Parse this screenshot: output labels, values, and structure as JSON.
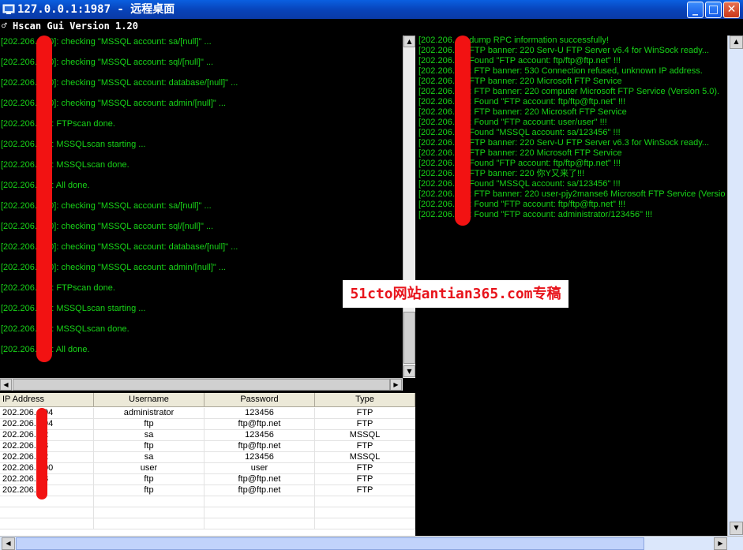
{
  "window": {
    "title": "127.0.0.1:1987 - 远程桌面",
    "minimize_glyph": "_",
    "maximize_glyph": "□",
    "close_glyph": "✕"
  },
  "app": {
    "title": "Hscan Gui Version 1.20"
  },
  "left_log": {
    "lines": [
      "[202.206.   100]: checking \"MSSQL account: sa/[null]\" ...",
      "[202.206.   100]: checking \"MSSQL account: sql/[null]\" ...",
      "[202.206.   100]: checking \"MSSQL account: database/[null]\" ...",
      "[202.206.   100]: checking \"MSSQL account: admin/[null]\" ...",
      "[202.206.   06]: FTPscan done.",
      "[202.206.   06]: MSSQLscan starting ...",
      "[202.206.   06]: MSSQLscan done.",
      "[202.206.   06]: All done.",
      "[202.206.   100]: checking \"MSSQL account: sa/[null]\" ...",
      "[202.206.   100]: checking \"MSSQL account: sql/[null]\" ...",
      "[202.206.   100]: checking \"MSSQL account: database/[null]\" ...",
      "[202.206.   100]: checking \"MSSQL account: admin/[null]\" ...",
      "[202.206.   94]: FTPscan done.",
      "[202.206.   94]: MSSQLscan starting ...",
      "[202.206.   94]: MSSQLscan done.",
      "[202.206.   94]: All done."
    ]
  },
  "right_log": {
    "lines": [
      "[202.206.    3]: dump RPC information successfully!",
      "[202.206.    1]: FTP banner: 220 Serv-U FTP Server v6.4 for WinSock ready...",
      "[202.206.    1]: Found \"FTP account: ftp/ftp@ftp.net\"  !!!",
      "[202.206.    01]: FTP banner: 530 Connection refused, unknown IP address.",
      "[202.206.    8]: FTP banner: 220 Microsoft FTP Service",
      "[202.206.    28]: FTP banner: 220 computer Microsoft FTP Service (Version 5.0).",
      "[202.206.    28]: Found \"FTP account: ftp/ftp@ftp.net\"  !!!",
      "[202.206.    00]: FTP banner: 220 Microsoft FTP Service",
      "[202.206.    00]: Found \"FTP account: user/user\" !!!",
      "[202.206.    2]: Found \"MSSQL account: sa/123456\" !!!",
      "[202.206.    7]: FTP banner: 220 Serv-U FTP Server v6.3 for WinSock ready...",
      "[202.206.    8]: FTP banner: 220 Microsoft FTP Service",
      "[202.206.    8]: Found \"FTP account: ftp/ftp@ftp.net\"  !!!",
      "[202.206.    6]: FTP banner: 220 你Y又来了!!!",
      "[202.206.    2]: Found \"MSSQL account: sa/123456\" !!!",
      "[202.206.    94]: FTP banner: 220 user-pjy2manse6 Microsoft FTP Service (Versio",
      "[202.206.    94]: Found \"FTP account: ftp/ftp@ftp.net\"  !!!",
      "[202.206.    94]: Found \"FTP account: administrator/123456\" !!!"
    ]
  },
  "results_table": {
    "columns": [
      "IP Address",
      "Username",
      "Password",
      "Type"
    ],
    "rows": [
      [
        "202.206.      194",
        "administrator",
        "123456",
        "FTP"
      ],
      [
        "202.206.      194",
        "ftp",
        "ftp@ftp.net",
        "FTP"
      ],
      [
        "202.206.      12",
        "sa",
        "123456",
        "MSSQL"
      ],
      [
        "202.206.      98",
        "ftp",
        "ftp@ftp.net",
        "FTP"
      ],
      [
        "202.206.      12",
        "sa",
        "123456",
        "MSSQL"
      ],
      [
        "202.206.      100",
        "user",
        "user",
        "FTP"
      ],
      [
        "202.206.      28",
        "ftp",
        "ftp@ftp.net",
        "FTP"
      ],
      [
        "202.206.      11",
        "ftp",
        "ftp@ftp.net",
        "FTP"
      ]
    ]
  },
  "watermark": {
    "text": "51cto网站antian365.com专稿"
  },
  "colors": {
    "log_text": "#18d418",
    "redaction": "#f21212",
    "watermark_text": "#e8141c",
    "titlebar": "#0842b8"
  }
}
